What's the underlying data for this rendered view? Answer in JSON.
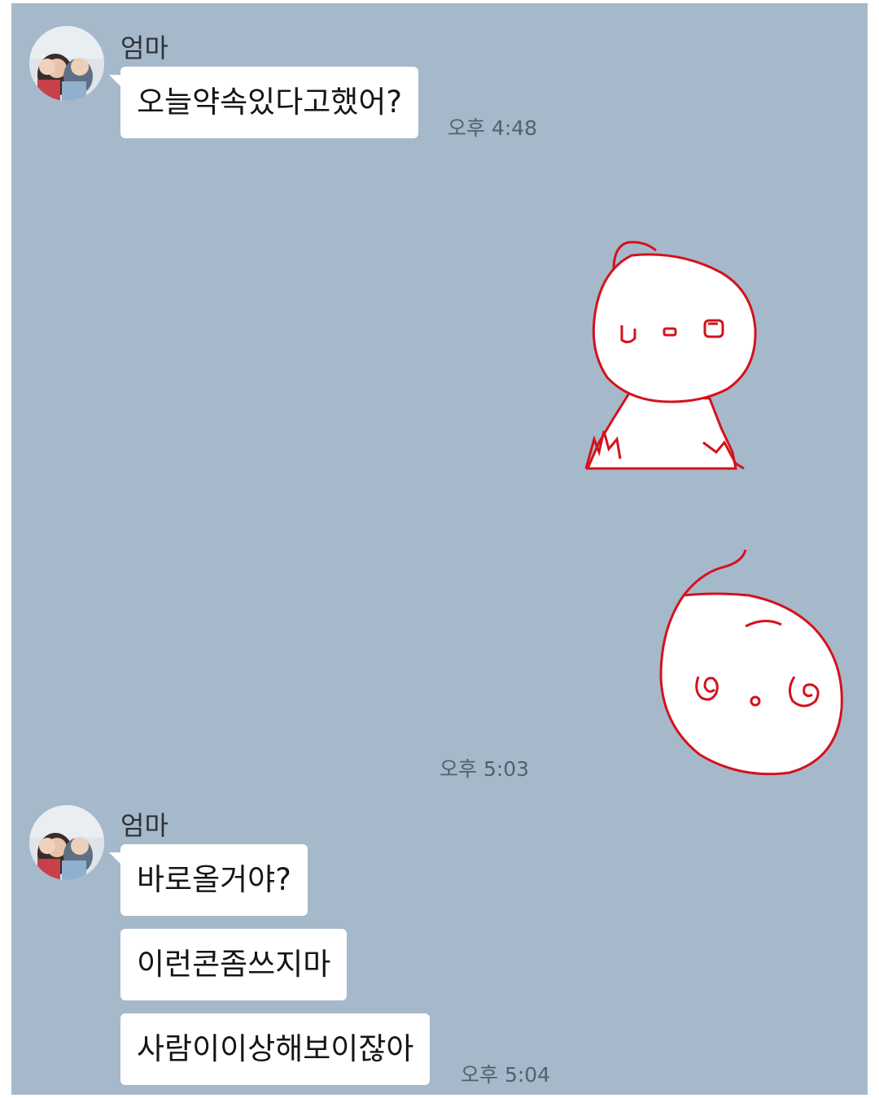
{
  "messages": [
    {
      "sender": "엄마",
      "avatar": "profile-photo",
      "bubbles": [
        "오늘약속있다고했어?"
      ],
      "time": "오후 4:48"
    },
    {
      "sender": "me",
      "stickers": [
        "drawn-character-sticker",
        "drawn-face-sticker"
      ],
      "time": "오후 5:03"
    },
    {
      "sender": "엄마",
      "avatar": "profile-photo",
      "bubbles": [
        "바로올거야?",
        "이런콘좀쓰지마",
        "사람이이상해보이잖아"
      ],
      "time": "오후 5:04"
    }
  ],
  "colors": {
    "background": "#a6b9cb",
    "bubble": "#ffffff",
    "sticker_outline": "#d4121c"
  }
}
